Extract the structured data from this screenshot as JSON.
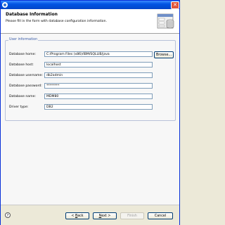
{
  "header": {
    "title": "Database Information",
    "description": "Please fill in the form with database configuration information."
  },
  "group": {
    "label": "User information",
    "fields": [
      {
        "label": "Database home:",
        "value": "C:/Program Files (x86)/IBM/SQLLIB/java"
      },
      {
        "label": "Database host:",
        "value": "localhost"
      },
      {
        "label": "Database username:",
        "value": "db2admin"
      },
      {
        "label": "Database password:",
        "value": "********"
      },
      {
        "label": "Database name:",
        "value": "MDM80"
      },
      {
        "label": "Driver type:",
        "value": "DB2"
      }
    ],
    "browse_label": "Browse..."
  },
  "footer": {
    "help_glyph": "?",
    "back_prefix": "< ",
    "back_mnemonic": "B",
    "back_rest": "ack",
    "next_mnemonic": "N",
    "next_rest": "ext >",
    "finish_label": "Finish",
    "cancel_label": "Cancel"
  },
  "icons": {
    "app": "app-icon",
    "close": "close-icon",
    "banner": "database-banner-icon",
    "help": "help-icon"
  },
  "colors": {
    "title_bar": "#0054e3",
    "group_label": "#3a5ca8"
  }
}
